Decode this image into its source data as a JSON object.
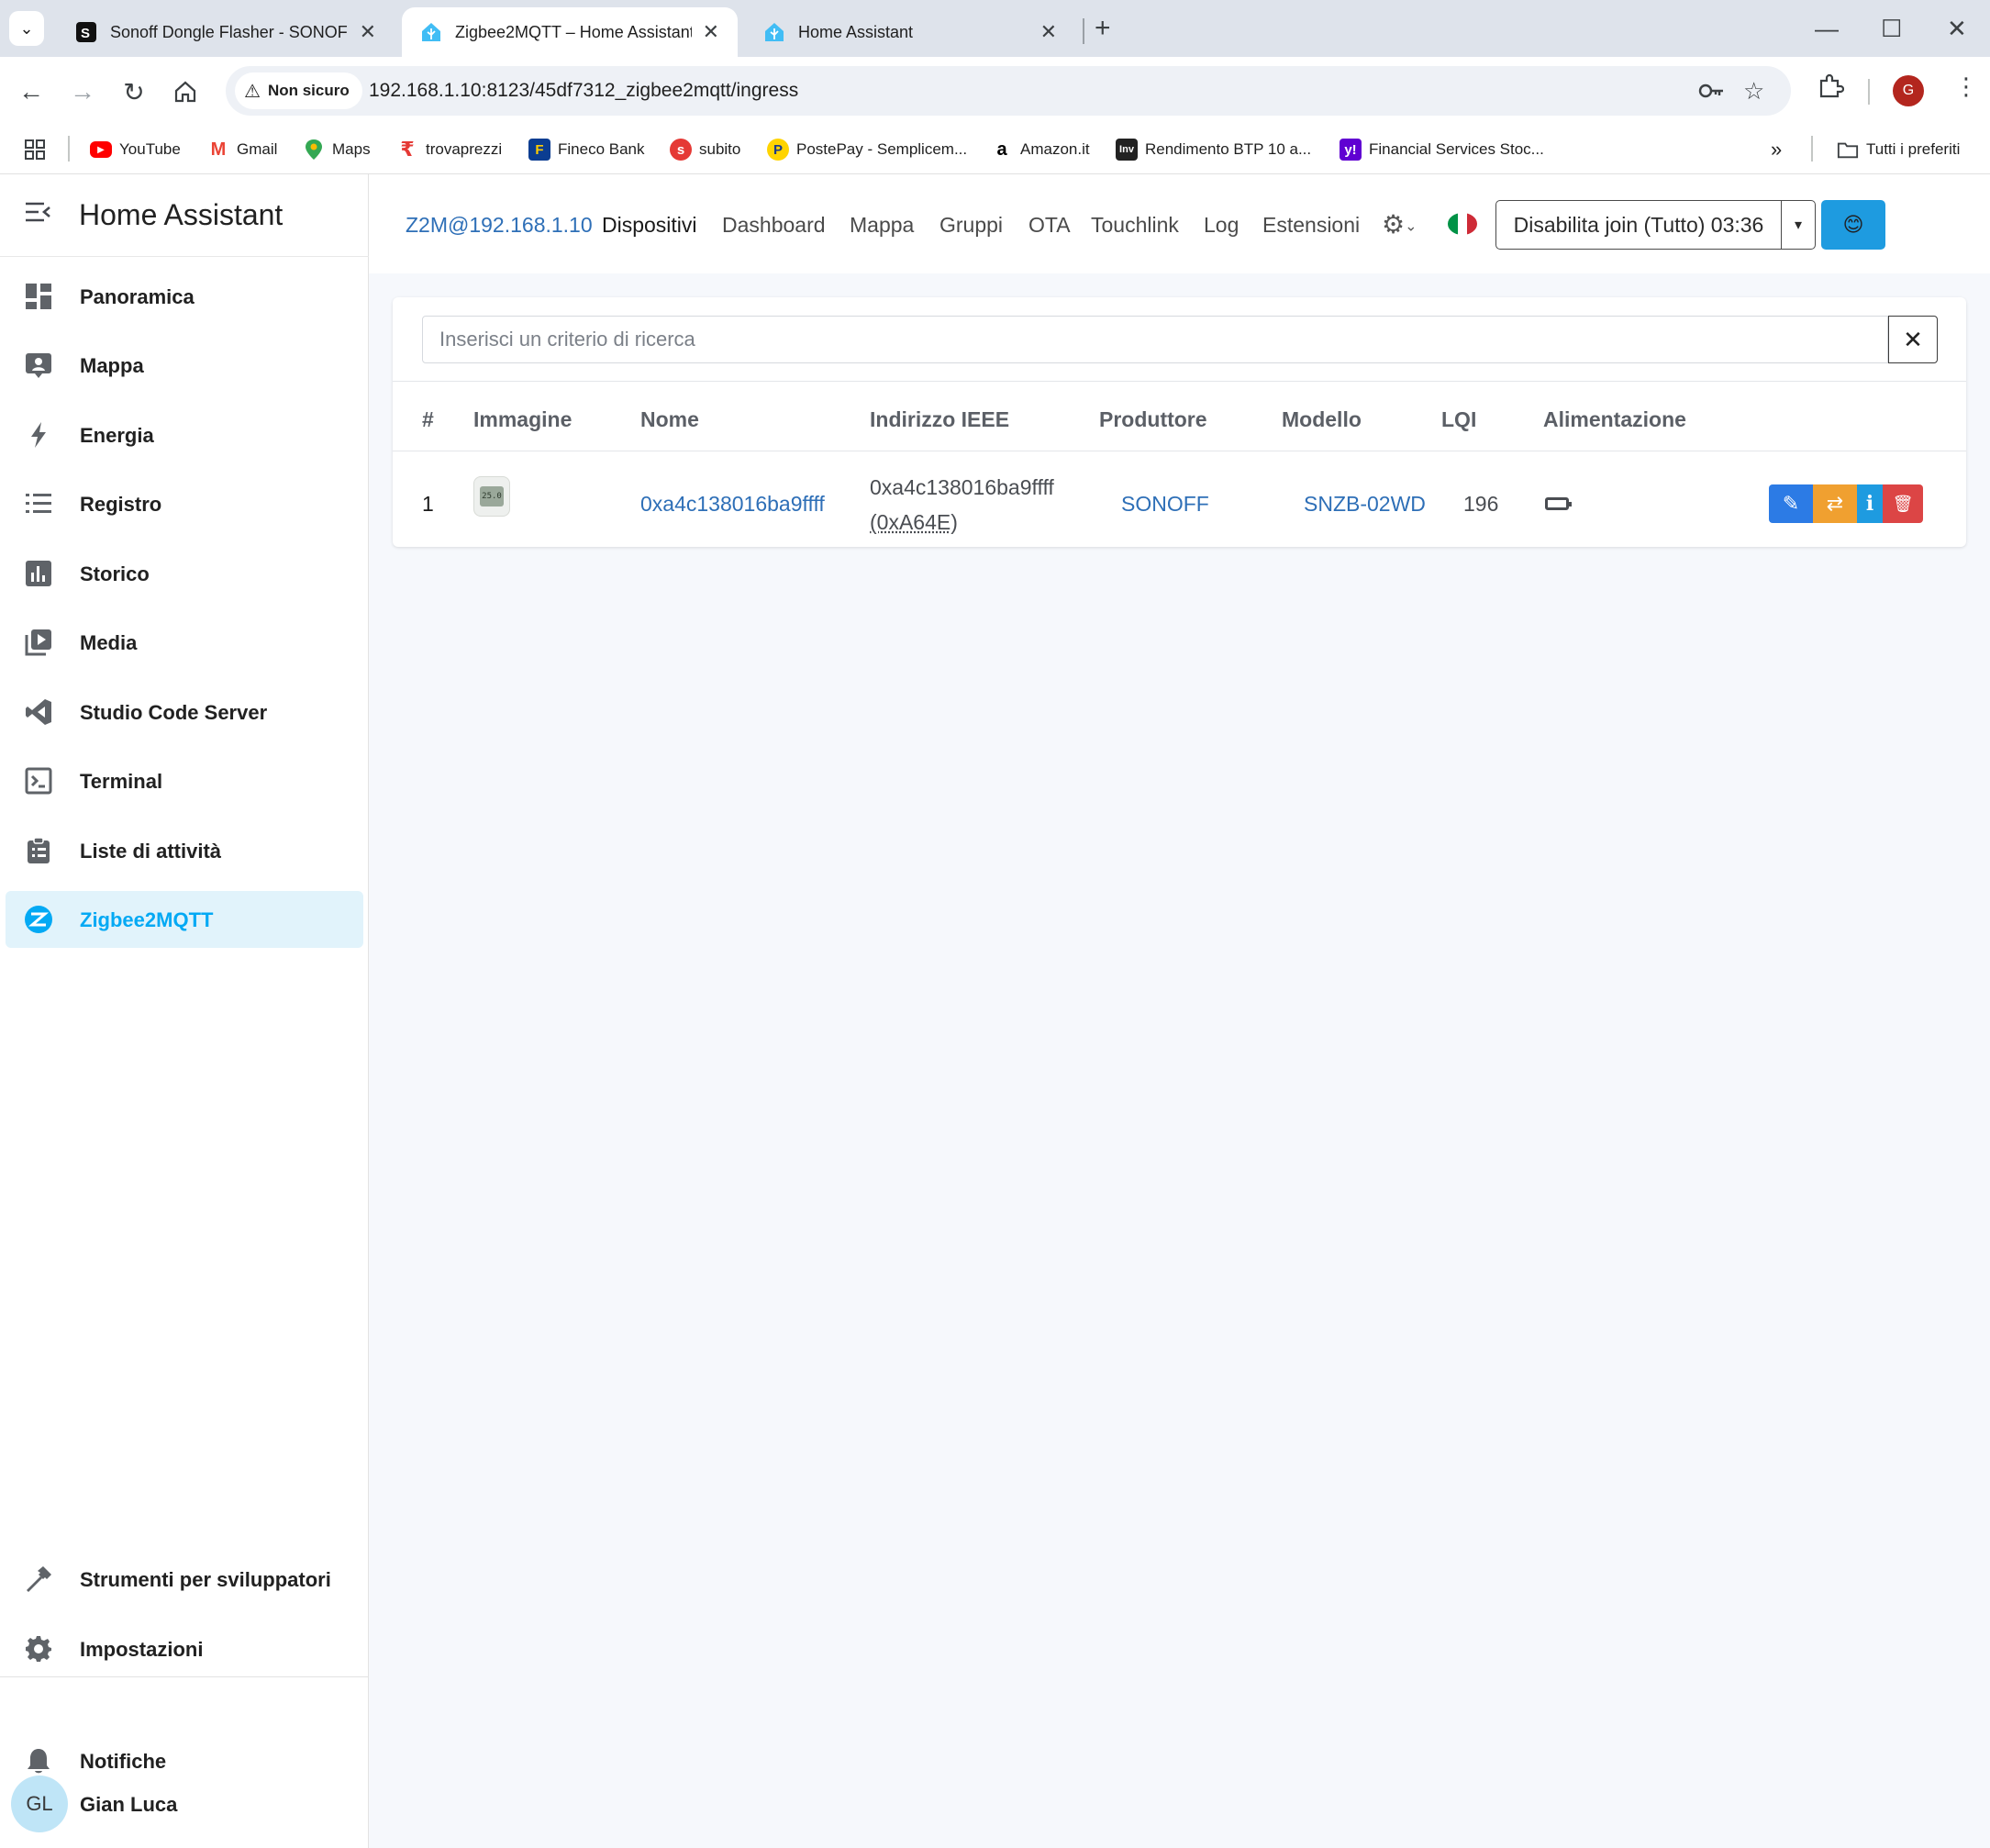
{
  "browser": {
    "tabs": [
      {
        "title": "Sonoff Dongle Flasher - SONOFF D",
        "favicon": "sonoff-favicon",
        "active": false
      },
      {
        "title": "Zigbee2MQTT – Home Assistant",
        "favicon": "home-assistant-favicon",
        "active": true
      },
      {
        "title": "Home Assistant",
        "favicon": "home-assistant-favicon",
        "active": false
      }
    ],
    "new_tab_glyph": "+",
    "security_label": "Non sicuro",
    "url": "192.168.1.10:8123/45df7312_zigbee2mqtt/ingress",
    "profile_initial": "G",
    "bookmarks": [
      {
        "label": "YouTube",
        "icon": "youtube-icon",
        "color": "#ff0000"
      },
      {
        "label": "Gmail",
        "icon": "gmail-icon",
        "color": "#ea4335"
      },
      {
        "label": "Maps",
        "icon": "maps-pin-icon",
        "color": "#34a853"
      },
      {
        "label": "trovaprezzi",
        "icon": "trovaprezzi-icon",
        "color": "#e53935"
      },
      {
        "label": "Fineco Bank",
        "icon": "fineco-icon",
        "color": "#0b3d91"
      },
      {
        "label": "subito",
        "icon": "subito-icon",
        "color": "#e53935"
      },
      {
        "label": "PostePay - Semplicem...",
        "icon": "postepay-icon",
        "color": "#ffd400"
      },
      {
        "label": "Amazon.it",
        "icon": "amazon-icon",
        "color": "#000000"
      },
      {
        "label": "Rendimento BTP 10 a...",
        "icon": "investing-icon",
        "color": "#222222"
      },
      {
        "label": "Financial Services Stoc...",
        "icon": "yahoo-icon",
        "color": "#6001d2"
      }
    ],
    "all_bookmarks_label": "Tutti i preferiti"
  },
  "sidebar": {
    "title": "Home Assistant",
    "items": [
      {
        "label": "Panoramica",
        "icon": "dashboard-grid-icon"
      },
      {
        "label": "Mappa",
        "icon": "map-account-icon"
      },
      {
        "label": "Energia",
        "icon": "lightning-bolt-icon"
      },
      {
        "label": "Registro",
        "icon": "list-icon"
      },
      {
        "label": "Storico",
        "icon": "chart-bar-icon"
      },
      {
        "label": "Media",
        "icon": "play-box-multiple-icon"
      },
      {
        "label": "Studio Code Server",
        "icon": "vscode-icon"
      },
      {
        "label": "Terminal",
        "icon": "console-icon"
      },
      {
        "label": "Liste di attività",
        "icon": "clipboard-list-icon"
      },
      {
        "label": "Zigbee2MQTT",
        "icon": "zigbee-icon",
        "active": true
      }
    ],
    "bottom_items": [
      {
        "label": "Strumenti per sviluppatori",
        "icon": "hammer-icon"
      },
      {
        "label": "Impostazioni",
        "icon": "cog-icon"
      }
    ],
    "notifications_label": "Notifiche",
    "user": {
      "initials": "GL",
      "name": "Gian Luca"
    },
    "accent_color": "#03a9f4"
  },
  "z2m": {
    "brand": "Z2M@192.168.1.10",
    "nav": [
      "Dispositivi",
      "Dashboard",
      "Mappa",
      "Gruppi",
      "OTA",
      "Touchlink",
      "Log",
      "Estensioni"
    ],
    "join_button": "Disabilita join (Tutto) 03:36",
    "emoji_button": "😊",
    "search_placeholder": "Inserisci un criterio di ricerca",
    "clear_glyph": "✕",
    "columns": [
      "#",
      "Immagine",
      "Nome",
      "Indirizzo IEEE",
      "Produttore",
      "Modello",
      "LQI",
      "Alimentazione"
    ],
    "device_image_text": "25.0",
    "rows": [
      {
        "index": "1",
        "name": "0xa4c138016ba9ffff",
        "ieee": "0xa4c138016ba9ffff",
        "nwk": "(0xA64E)",
        "vendor": "SONOFF",
        "model": "SNZB-02WD",
        "lqi": "196",
        "power": "battery-icon"
      }
    ],
    "action_colors": {
      "edit": "#2c7be5",
      "reconfigure": "#f0a030",
      "info": "#1e9be0",
      "remove": "#dc4545"
    },
    "action_glyphs": {
      "edit": "✎",
      "reconfigure": "⇄",
      "info": "i",
      "remove": "🗑"
    }
  }
}
